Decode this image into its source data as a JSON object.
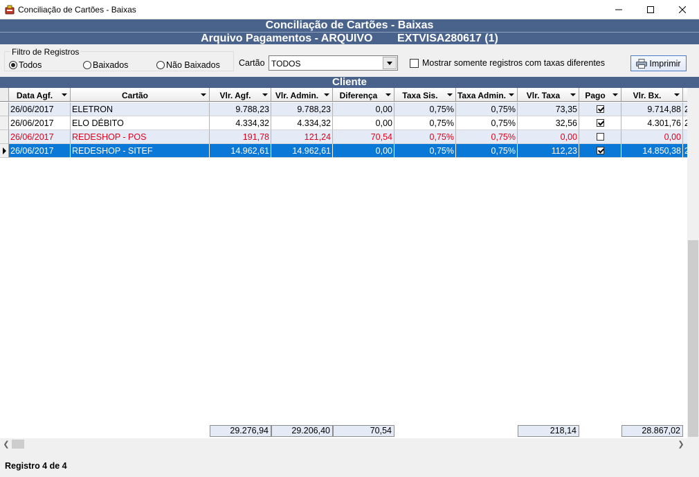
{
  "window": {
    "title": "Conciliação de Cartões - Baixas"
  },
  "header": {
    "title": "Conciliação de Cartões - Baixas",
    "file_label": "Arquivo Pagamentos - ARQUIVO",
    "file_name": "EXTVISA280617 (1)"
  },
  "filter": {
    "legend": "Filtro de Registros",
    "options": [
      {
        "label": "Todos",
        "selected": true
      },
      {
        "label": "Baixados",
        "selected": false
      },
      {
        "label": "Não Baixados",
        "selected": false
      }
    ]
  },
  "cartao": {
    "label": "Cartão",
    "value": "TODOS"
  },
  "only_diff": {
    "label": "Mostrar somente registros com taxas diferentes",
    "checked": false
  },
  "print_label": "Imprimir",
  "section_title": "Cliente",
  "columns": [
    "Data Agf.",
    "Cartão",
    "Vlr. Agf.",
    "Vlr. Admin.",
    "Diferença",
    "Taxa Sis.",
    "Taxa Admin.",
    "Vlr. Taxa",
    "Pago",
    "Vlr. Bx."
  ],
  "rows": [
    {
      "data": "26/06/2017",
      "cartao": "ELETRON",
      "vlr_agf": "9.788,23",
      "vlr_admin": "9.788,23",
      "diferenca": "0,00",
      "taxa_sis": "0,75%",
      "taxa_admin": "0,75%",
      "vlr_taxa": "73,35",
      "pago": true,
      "vlr_bx": "9.714,88",
      "overflow": "2"
    },
    {
      "data": "26/06/2017",
      "cartao": "ELO DÉBITO",
      "vlr_agf": "4.334,32",
      "vlr_admin": "4.334,32",
      "diferenca": "0,00",
      "taxa_sis": "0,75%",
      "taxa_admin": "0,75%",
      "vlr_taxa": "32,56",
      "pago": true,
      "vlr_bx": "4.301,76",
      "overflow": "2"
    },
    {
      "data": "26/06/2017",
      "cartao": "REDESHOP - POS",
      "vlr_agf": "191,78",
      "vlr_admin": "121,24",
      "diferenca": "70,54",
      "taxa_sis": "0,75%",
      "taxa_admin": "0,75%",
      "vlr_taxa": "0,00",
      "pago": false,
      "vlr_bx": "0,00",
      "overflow": ""
    },
    {
      "data": "26/06/2017",
      "cartao": "REDESHOP - SITEF",
      "vlr_agf": "14.962,61",
      "vlr_admin": "14.962,61",
      "diferenca": "0,00",
      "taxa_sis": "0,75%",
      "taxa_admin": "0,75%",
      "vlr_taxa": "112,23",
      "pago": true,
      "vlr_bx": "14.850,38",
      "overflow": "2"
    }
  ],
  "totals": {
    "vlr_agf": "29.276,94",
    "vlr_admin": "29.206,40",
    "diferenca": "70,54",
    "vlr_taxa": "218,14",
    "vlr_bx": "28.867,02"
  },
  "status": "Registro 4 de 4",
  "colors": {
    "banner": "#4a638c",
    "selection": "#0a78d7",
    "alt_row": "#e4ebf6",
    "difference_text": "#e0001b"
  }
}
